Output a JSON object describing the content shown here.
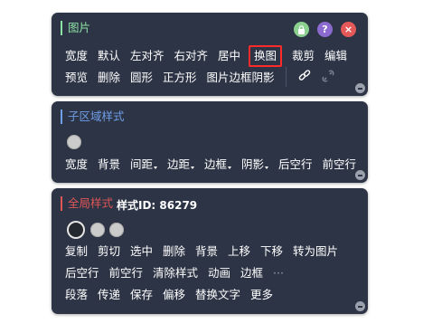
{
  "image_panel": {
    "title": "图片",
    "row1": [
      "宽度",
      "默认",
      "左对齐",
      "右对齐",
      "居中",
      "换图",
      "裁剪",
      "编辑"
    ],
    "row2": [
      "预览",
      "删除",
      "圆形",
      "正方形",
      "图片边框阴影"
    ],
    "icons": {
      "lock": "lock-icon",
      "help": "?",
      "close": "×",
      "link": "link-icon",
      "unlink": "unlink-icon"
    },
    "highlighted": "换图"
  },
  "sub_panel": {
    "title": "子区域样式",
    "row1": [
      "宽度",
      "背景",
      "间距",
      "边距",
      "边框",
      "阴影",
      "后空行",
      "前空行"
    ]
  },
  "global_panel": {
    "title": "全局样式",
    "style_id": "样式ID: 86279",
    "row1": [
      "复制",
      "剪切",
      "选中",
      "删除",
      "背景",
      "上移",
      "下移",
      "转为图片"
    ],
    "row2": [
      "后空行",
      "前空行",
      "清除样式",
      "动画",
      "边框",
      "···"
    ],
    "row3": [
      "段落",
      "传递",
      "保存",
      "偏移",
      "替换文字",
      "更多"
    ]
  },
  "colors": {
    "panel_bg": "#2d3445",
    "image_accent": "#8be0a4",
    "sub_accent": "#6f9fe8",
    "global_accent": "#e05656",
    "highlight": "#ff2b2b"
  }
}
